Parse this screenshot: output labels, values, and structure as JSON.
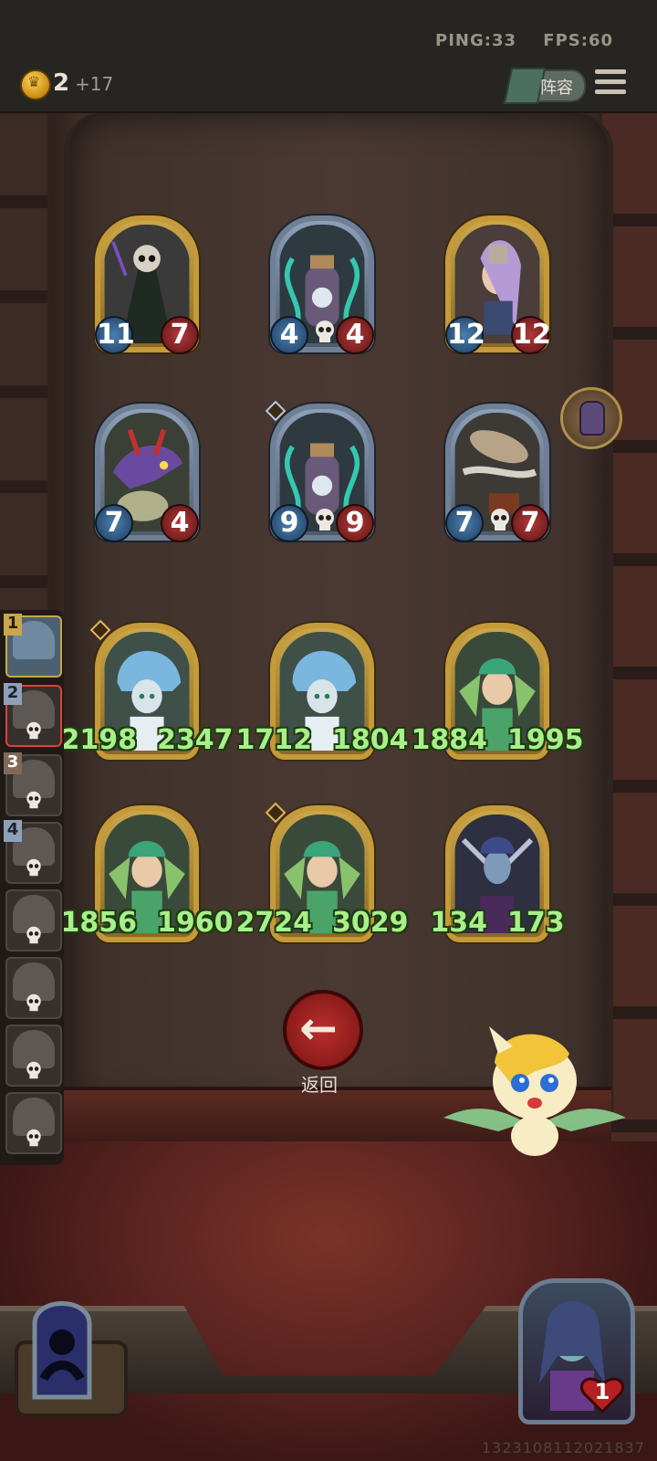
{
  "status": {
    "ping": "PING:33",
    "fps": "FPS:60"
  },
  "header": {
    "gold": "2",
    "gold_bonus": "+17",
    "lineup_label": "阵容"
  },
  "board": {
    "enemy_rows": [
      [
        {
          "frame": "gold",
          "atk": "11",
          "hp": "7",
          "skull": false
        },
        {
          "frame": "blue",
          "atk": "4",
          "hp": "4",
          "skull": true
        },
        {
          "frame": "gold",
          "atk": "12",
          "hp": "12",
          "skull": false
        }
      ],
      [
        {
          "frame": "blue",
          "atk": "7",
          "hp": "4",
          "skull": false
        },
        {
          "frame": "blue",
          "atk": "9",
          "hp": "9",
          "skull": true
        },
        {
          "frame": "blue",
          "atk": "7",
          "hp": "7",
          "skull": true
        }
      ]
    ],
    "ally_rows": [
      [
        {
          "frame": "gold",
          "atk": "2198",
          "hp": "2347"
        },
        {
          "frame": "gold",
          "atk": "1712",
          "hp": "1804"
        },
        {
          "frame": "gold",
          "atk": "1884",
          "hp": "1995"
        }
      ],
      [
        {
          "frame": "gold",
          "atk": "1856",
          "hp": "1960"
        },
        {
          "frame": "gold",
          "atk": "2724",
          "hp": "3029"
        },
        {
          "frame": "gold",
          "atk": "134",
          "hp": "173"
        }
      ]
    ]
  },
  "roster": {
    "slots": [
      "1",
      "2",
      "3",
      "4"
    ]
  },
  "back_label": "返回",
  "player": {
    "lives": "1"
  },
  "uid": "1323108112021837"
}
